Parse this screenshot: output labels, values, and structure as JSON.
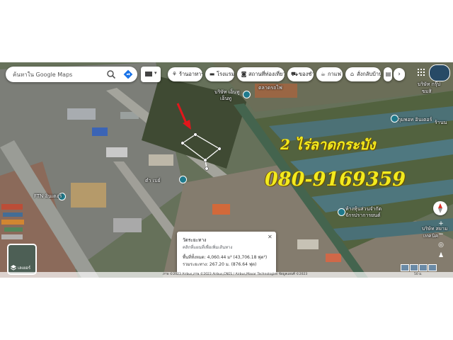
{
  "search": {
    "placeholder": "ค้นหาใน Google Maps"
  },
  "categories": [
    {
      "label": "ร้านอาหาร",
      "icon": "fork-knife-icon"
    },
    {
      "label": "โรงแรม",
      "icon": "bed-icon"
    },
    {
      "label": "สถานที่ท่องเที่ยว",
      "icon": "camera-icon"
    },
    {
      "label": "ของชำ",
      "icon": "cart-icon"
    },
    {
      "label": "กาแฟ",
      "icon": "coffee-icon"
    },
    {
      "label": "สั่งกลับบ้าน",
      "icon": "takeout-icon"
    }
  ],
  "map_labels": [
    "ตลาดรถไฟ",
    "บริษัท เอ็นทู",
    "เอ็นทู",
    "บริษัท กรุ๊ป",
    "ขมสิ",
    "กุมพอท อินเตอร์",
    "ร้านน",
    "ตำ เบย์",
    "FTN อินเตอร์",
    "ห้างหุ้นส่วนจำกัด",
    "จักรปราการยนต์",
    "บริษัท สยาม",
    "เทคนิค"
  ],
  "overlay": {
    "title": "2 ไร่ลาดกระบัง",
    "phone": "080-9169359"
  },
  "layers_button": {
    "label": "เลเยอร์"
  },
  "measure_card": {
    "title": "วัดระยะทาง",
    "hint": "คลิกที่แผนที่เพื่อเพิ่มเส้นทาง",
    "area": "พื้นที่ทั้งหมด: 4,060.44 ม² (43,706.18 ฟุต²)",
    "distance": "รวมระยะทาง: 267.20 ม. (876.64 ฟุต)"
  },
  "footer": {
    "attribution": "ภาพ ©2023 Airbus,ภาพ ©2023 Airbus,CNES / Airbus,Maxar Technologies ข้อมูลแผนที่ ©2023",
    "scale": "50 ม."
  },
  "colors": {
    "arrow": "#e3161b",
    "overlay_text": "#f2ea1e",
    "measure_line": "#ffffff"
  }
}
